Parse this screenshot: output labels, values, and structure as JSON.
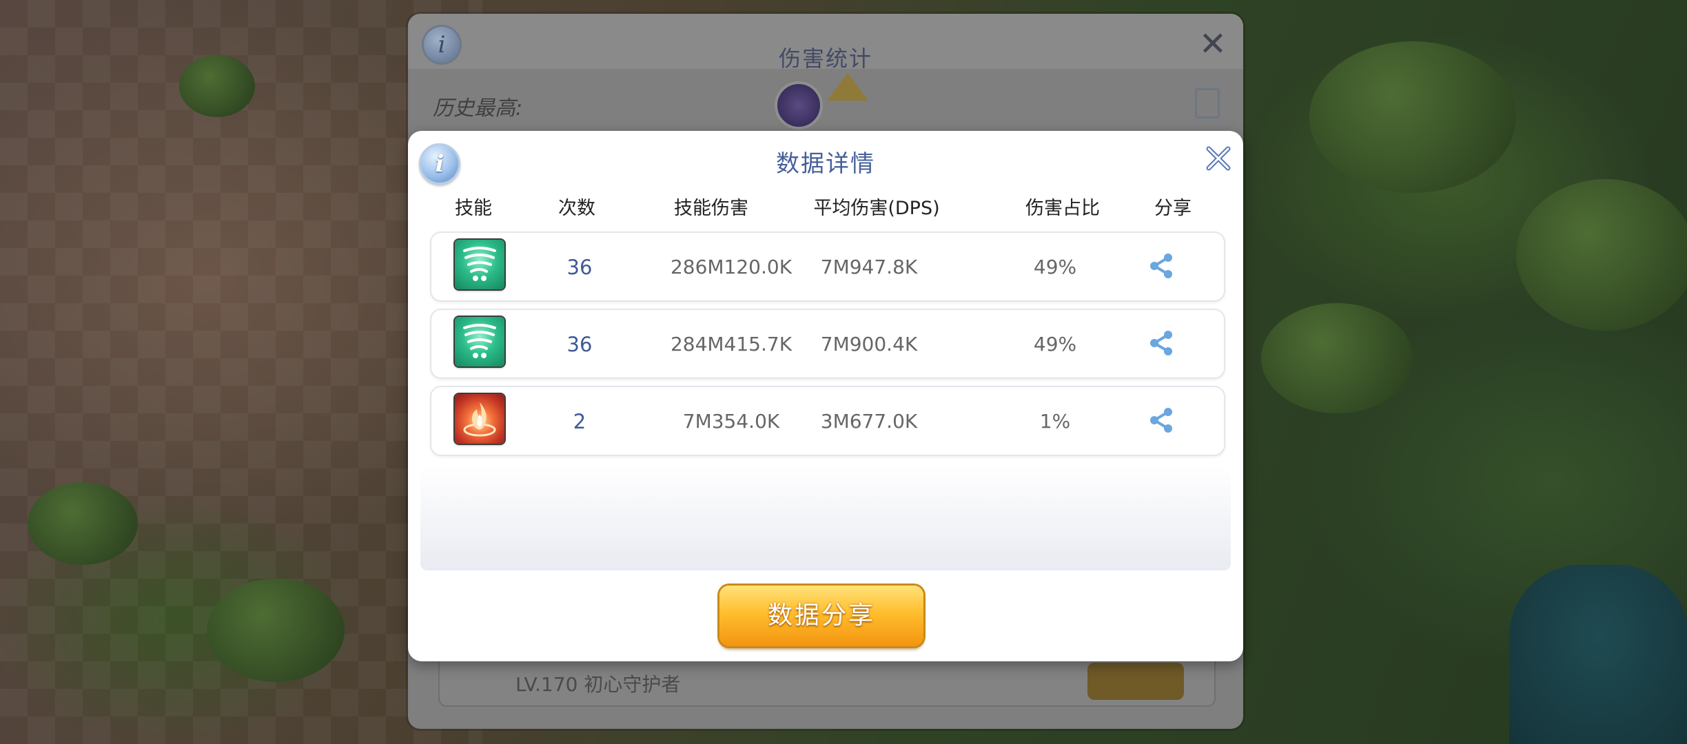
{
  "background_panel": {
    "title": "伤害统计",
    "history_best_label": "历史最高:",
    "footer_text": "LV.170 初心守护者"
  },
  "dialog": {
    "title": "数据详情",
    "columns": {
      "skill": "技能",
      "count": "次数",
      "skill_damage": "技能伤害",
      "avg_damage": "平均伤害(DPS)",
      "damage_share": "伤害占比",
      "share": "分享"
    },
    "rows": [
      {
        "icon": "wind-skill-icon",
        "count": "36",
        "skill_damage": "286M120.0K",
        "avg_damage": "7M947.8K",
        "ratio": "49%"
      },
      {
        "icon": "wind-skill-icon",
        "count": "36",
        "skill_damage": "284M415.7K",
        "avg_damage": "7M900.4K",
        "ratio": "49%"
      },
      {
        "icon": "fire-skill-icon",
        "count": "2",
        "skill_damage": "7M354.0K",
        "avg_damage": "3M677.0K",
        "ratio": "1%"
      }
    ],
    "share_button_label": "数据分享"
  },
  "colors": {
    "title": "#46609a",
    "count": "#3e5a96",
    "share_icon": "#6aa6e0",
    "button_top": "#ffe27a",
    "button_bottom": "#f49410"
  }
}
